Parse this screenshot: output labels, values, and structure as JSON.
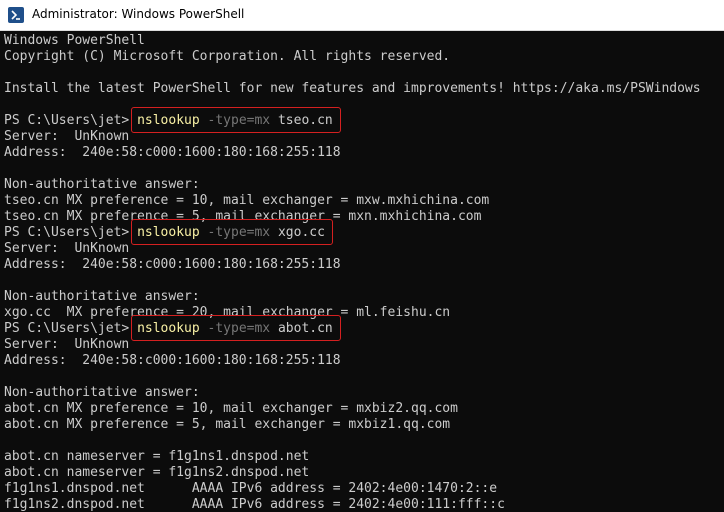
{
  "window": {
    "title": "Administrator: Windows PowerShell",
    "icon": "powershell-icon"
  },
  "console": {
    "banner": [
      "Windows PowerShell",
      "Copyright (C) Microsoft Corporation. All rights reserved.",
      "",
      "Install the latest PowerShell for new features and improvements! https://aka.ms/PSWindows",
      ""
    ],
    "prompt": "PS C:\\Users\\jet> ",
    "sessions": [
      {
        "command": "nslookup",
        "flag": "-type=mx",
        "domain": "tseo.cn",
        "output": [
          "Server:  UnKnown",
          "Address:  240e:58:c000:1600:180:168:255:118",
          "",
          "Non-authoritative answer:",
          "tseo.cn MX preference = 10, mail exchanger = mxw.mxhichina.com",
          "tseo.cn MX preference = 5, mail exchanger = mxn.mxhichina.com"
        ]
      },
      {
        "command": "nslookup",
        "flag": "-type=mx",
        "domain": "xgo.cc",
        "output": [
          "Server:  UnKnown",
          "Address:  240e:58:c000:1600:180:168:255:118",
          "",
          "Non-authoritative answer:",
          "xgo.cc  MX preference = 20, mail exchanger = ml.feishu.cn"
        ]
      },
      {
        "command": "nslookup",
        "flag": "-type=mx",
        "domain": "abot.cn",
        "output": [
          "Server:  UnKnown",
          "Address:  240e:58:c000:1600:180:168:255:118",
          "",
          "Non-authoritative answer:",
          "abot.cn MX preference = 10, mail exchanger = mxbiz2.qq.com",
          "abot.cn MX preference = 5, mail exchanger = mxbiz1.qq.com",
          "",
          "abot.cn nameserver = f1g1ns1.dnspod.net",
          "abot.cn nameserver = f1g1ns2.dnspod.net",
          "f1g1ns1.dnspod.net      AAAA IPv6 address = 2402:4e00:1470:2::e",
          "f1g1ns2.dnspod.net      AAAA IPv6 address = 2402:4e00:111:fff::c"
        ]
      }
    ]
  },
  "colors": {
    "background": "#0c0c0c",
    "text": "#cccccc",
    "command": "#f9f1a5",
    "parameter": "#767676",
    "highlight_box": "#d42020"
  }
}
